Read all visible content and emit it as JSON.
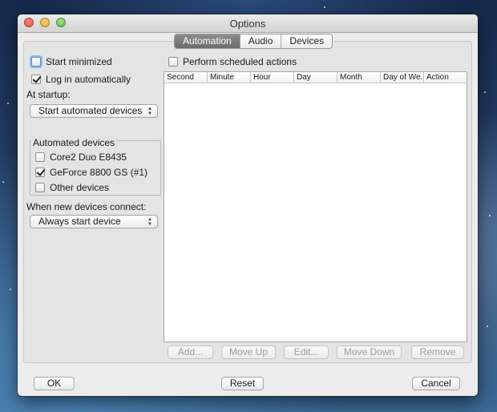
{
  "window": {
    "title": "Options"
  },
  "tabs": [
    {
      "label": "Automation",
      "active": true
    },
    {
      "label": "Audio",
      "active": false
    },
    {
      "label": "Devices",
      "active": false
    }
  ],
  "left": {
    "start_minimized": {
      "label": "Start minimized",
      "checked": false
    },
    "log_in_auto": {
      "label": "Log in automatically",
      "checked": true
    },
    "at_startup_label": "At startup:",
    "at_startup_value": "Start automated devices",
    "automated_devices": {
      "title": "Automated devices",
      "items": [
        {
          "label": "Core2 Duo E8435",
          "checked": false
        },
        {
          "label": "GeForce 8800 GS (#1)",
          "checked": true
        },
        {
          "label": "Other devices",
          "checked": false
        }
      ]
    },
    "new_devices_label": "When new devices connect:",
    "new_devices_value": "Always start device"
  },
  "schedule": {
    "perform_label": "Perform scheduled actions",
    "perform_checked": false,
    "columns": [
      "Second",
      "Minute",
      "Hour",
      "Day",
      "Month",
      "Day of We...",
      "Action"
    ],
    "buttons": {
      "add": "Add...",
      "move_up": "Move Up",
      "edit": "Edit...",
      "move_down": "Move Down",
      "remove": "Remove"
    }
  },
  "footer": {
    "ok": "OK",
    "reset": "Reset",
    "cancel": "Cancel"
  },
  "colors": {
    "active_tab": "#7a7a7a",
    "focus_ring": "#8db7e8",
    "window_bg": "#ececec"
  }
}
